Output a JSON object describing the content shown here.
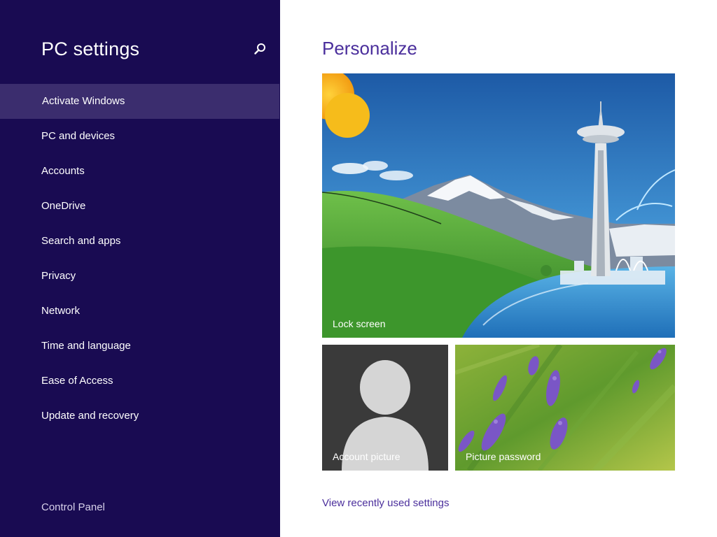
{
  "sidebar": {
    "title": "PC settings",
    "search_icon": "search-icon",
    "items": [
      {
        "label": "Activate Windows",
        "selected": true
      },
      {
        "label": "PC and devices"
      },
      {
        "label": "Accounts"
      },
      {
        "label": "OneDrive"
      },
      {
        "label": "Search and apps"
      },
      {
        "label": "Privacy"
      },
      {
        "label": "Network"
      },
      {
        "label": "Time and language"
      },
      {
        "label": "Ease of Access"
      },
      {
        "label": "Update and recovery"
      }
    ],
    "footer_link": "Control Panel"
  },
  "main": {
    "title": "Personalize",
    "tiles": {
      "lock_screen": "Lock screen",
      "account_picture": "Account picture",
      "picture_password": "Picture password"
    },
    "recent_link": "View recently used settings"
  },
  "colors": {
    "sidebar_bg": "#190b52",
    "sidebar_selected_bg": "#3b2d6e",
    "accent": "#4b2f9c"
  }
}
